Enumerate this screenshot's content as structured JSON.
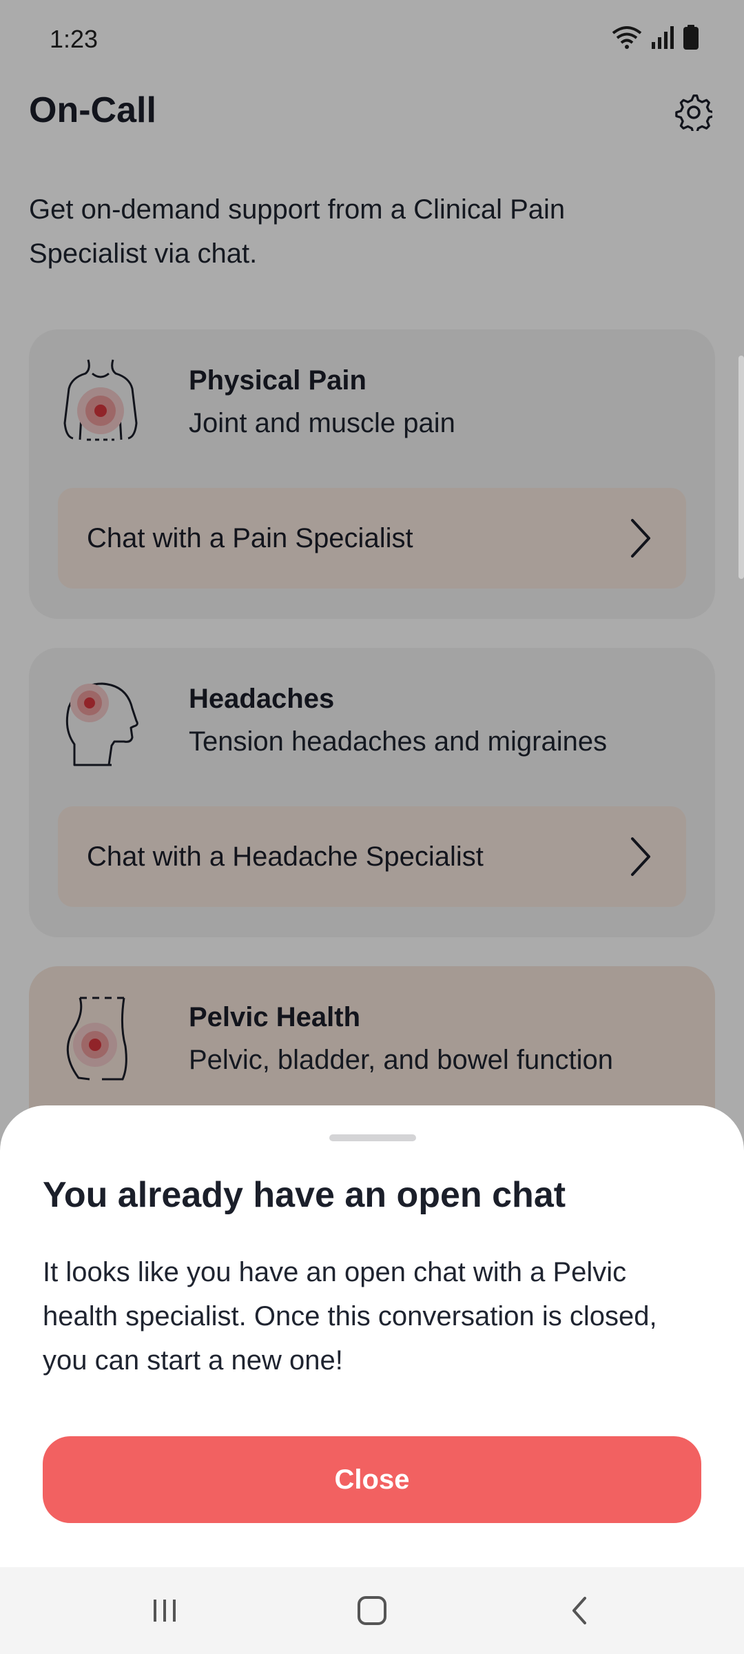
{
  "status_bar": {
    "time": "1:23"
  },
  "header": {
    "title": "On-Call"
  },
  "intro": {
    "text": "Get on-demand support from a Clinical Pain Specialist via chat."
  },
  "cards": [
    {
      "title": "Physical Pain",
      "subtitle": "Joint and muscle pain",
      "button_label": "Chat with a Pain Specialist",
      "icon": "torso-pain-icon"
    },
    {
      "title": "Headaches",
      "subtitle": "Tension headaches and migraines",
      "button_label": "Chat with a Headache Specialist",
      "icon": "head-pain-icon"
    },
    {
      "title": "Pelvic Health",
      "subtitle": "Pelvic, bladder, and bowel function",
      "icon": "pelvis-pain-icon"
    }
  ],
  "sheet": {
    "title": "You already have an open chat",
    "body": "It looks like you have an open chat with a Pelvic health specialist. Once this conversation is closed, you can start a new one!",
    "close_label": "Close"
  },
  "colors": {
    "accent": "#f26161",
    "card_bg": "#f3f3f3",
    "pelvic_card_bg": "#f7e6dc",
    "pain_marker": "#d9363e"
  },
  "icons": [
    "wifi-icon",
    "signal-icon",
    "battery-icon",
    "gear-icon",
    "chevron-right-icon",
    "recents-icon",
    "home-icon",
    "back-icon"
  ]
}
